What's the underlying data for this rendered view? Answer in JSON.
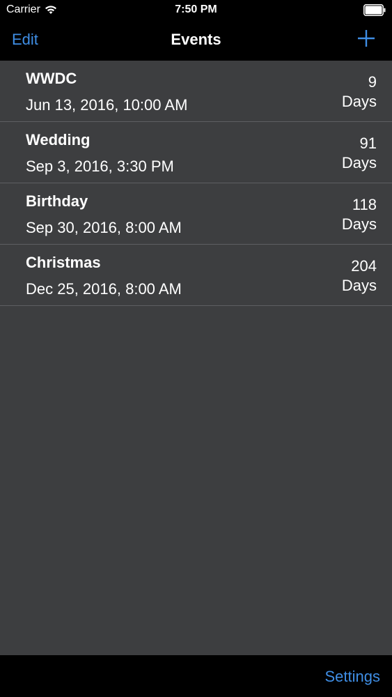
{
  "status_bar": {
    "carrier": "Carrier",
    "time": "7:50 PM",
    "wifi_icon": "wifi-icon",
    "battery_icon": "battery-icon"
  },
  "nav": {
    "edit_label": "Edit",
    "title": "Events",
    "add_icon": "plus-icon"
  },
  "events": [
    {
      "title": "WWDC",
      "date": "Jun 13, 2016, 10:00 AM",
      "count": "9",
      "unit": "Days"
    },
    {
      "title": "Wedding",
      "date": "Sep 3, 2016, 3:30 PM",
      "count": "91",
      "unit": "Days"
    },
    {
      "title": "Birthday",
      "date": "Sep 30, 2016, 8:00 AM",
      "count": "118",
      "unit": "Days"
    },
    {
      "title": "Christmas",
      "date": "Dec 25, 2016, 8:00 AM",
      "count": "204",
      "unit": "Days"
    }
  ],
  "toolbar": {
    "settings_label": "Settings"
  },
  "colors": {
    "accent": "#3f8ee5",
    "background": "#3d3e40",
    "bar": "#000000",
    "separator": "#5e5f62"
  }
}
